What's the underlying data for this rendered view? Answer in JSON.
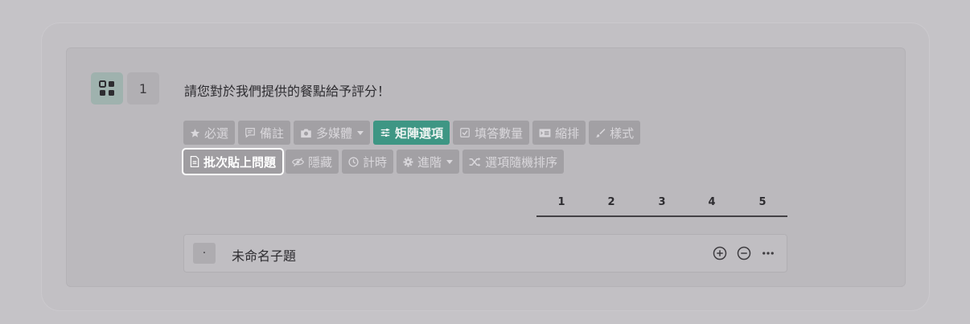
{
  "question": {
    "number": "1",
    "text": "請您對於我們提供的餐點給予評分！"
  },
  "toolbar_row1": [
    {
      "label": "必選",
      "icon": "star-icon"
    },
    {
      "label": "備註",
      "icon": "comment-icon"
    },
    {
      "label": "多媒體",
      "icon": "camera-icon",
      "dropdown": true
    },
    {
      "label": "矩陣選項",
      "icon": "sliders-icon",
      "active": true
    },
    {
      "label": "填答數量",
      "icon": "checkbox-icon"
    },
    {
      "label": "縮排",
      "icon": "indent-icon"
    },
    {
      "label": "樣式",
      "icon": "brush-icon"
    }
  ],
  "toolbar_row2": [
    {
      "label": "批次貼上問題",
      "icon": "document-icon",
      "highlighted": true
    },
    {
      "label": "隱藏",
      "icon": "eye-slash-icon"
    },
    {
      "label": "計時",
      "icon": "clock-icon"
    },
    {
      "label": "進階",
      "icon": "gear-icon",
      "dropdown": true
    },
    {
      "label": "選項隨機排序",
      "icon": "shuffle-icon"
    }
  ],
  "scale": [
    "1",
    "2",
    "3",
    "4",
    "5"
  ],
  "sub_question": {
    "bullet": "·",
    "title": "未命名子題"
  },
  "colors": {
    "accent": "#3e9684",
    "highlight_border": "#ffffff"
  }
}
